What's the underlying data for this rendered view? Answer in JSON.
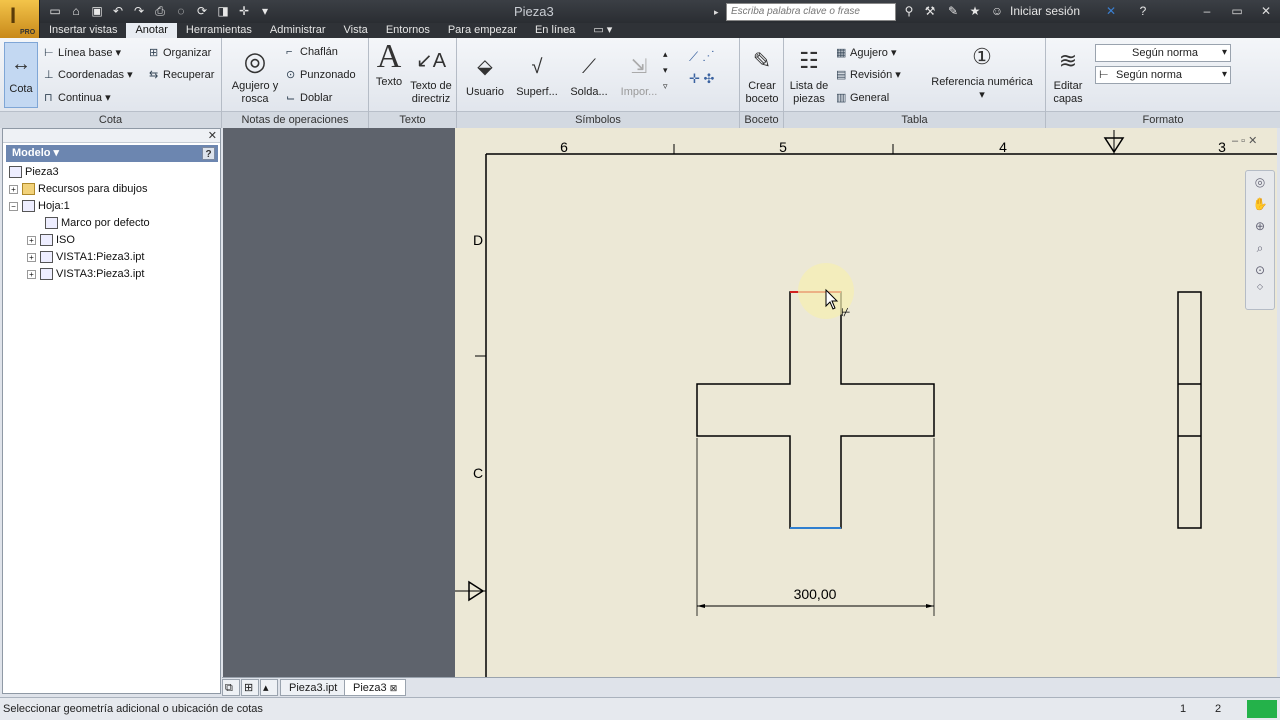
{
  "app": {
    "title": "Pieza3",
    "edition": "PRO"
  },
  "search": {
    "placeholder": "Escriba palabra clave o frase"
  },
  "login": {
    "label": "Iniciar sesión"
  },
  "menu": {
    "tabs": [
      "Insertar vistas",
      "Anotar",
      "Herramientas",
      "Administrar",
      "Vista",
      "Entornos",
      "Para empezar",
      "En línea"
    ],
    "active": "Anotar"
  },
  "ribbon": {
    "cota": {
      "title": "Cota",
      "cota_btn": "Cota",
      "linea_base": "Línea base",
      "coordenadas": "Coordenadas",
      "continua": "Continua",
      "organizar": "Organizar",
      "recuperar": "Recuperar"
    },
    "notas": {
      "title": "Notas de operaciones",
      "agujero_1": "Agujero y",
      "agujero_2": "rosca",
      "chaflan": "Chaflán",
      "punzonado": "Punzonado",
      "doblar": "Doblar"
    },
    "texto": {
      "title": "Texto",
      "texto": "Texto",
      "directriz_1": "Texto de",
      "directriz_2": "directriz"
    },
    "simbolos": {
      "title": "Símbolos",
      "usuario": "Usuario",
      "superf": "Superf...",
      "solda": "Solda...",
      "impor": "Impor..."
    },
    "boceto": {
      "title": "Boceto",
      "crear_1": "Crear",
      "crear_2": "boceto"
    },
    "tabla": {
      "title": "Tabla",
      "lista_1": "Lista de",
      "lista_2": "piezas",
      "agujero": "Agujero",
      "revision": "Revisión",
      "general": "General",
      "referencia": "Referencia numérica"
    },
    "formato": {
      "title": "Formato",
      "editar_1": "Editar",
      "editar_2": "capas",
      "estilo1": "Según norma",
      "estilo2": "Según norma"
    }
  },
  "browser": {
    "header": "Modelo",
    "nodes": [
      "Pieza3",
      "Recursos para dibujos",
      "Hoja:1",
      "Marco por defecto",
      "ISO",
      "VISTA1:Pieza3.ipt",
      "VISTA3:Pieza3.ipt"
    ]
  },
  "drawing": {
    "zone_cols": [
      "6",
      "5",
      "4",
      "3"
    ],
    "zone_rows": [
      "D",
      "C"
    ],
    "dimension": "300,00"
  },
  "sheet_tabs": [
    "Pieza3.ipt",
    "Pieza3"
  ],
  "status": {
    "text": "Seleccionar geometría adicional o ubicación de cotas",
    "count1": "1",
    "count2": "2"
  },
  "colors": {
    "sheet": "#ece8d6",
    "highlight_edge": "#d22020",
    "blue_edge": "#2f7fd0",
    "status_green": "#24b24a"
  }
}
